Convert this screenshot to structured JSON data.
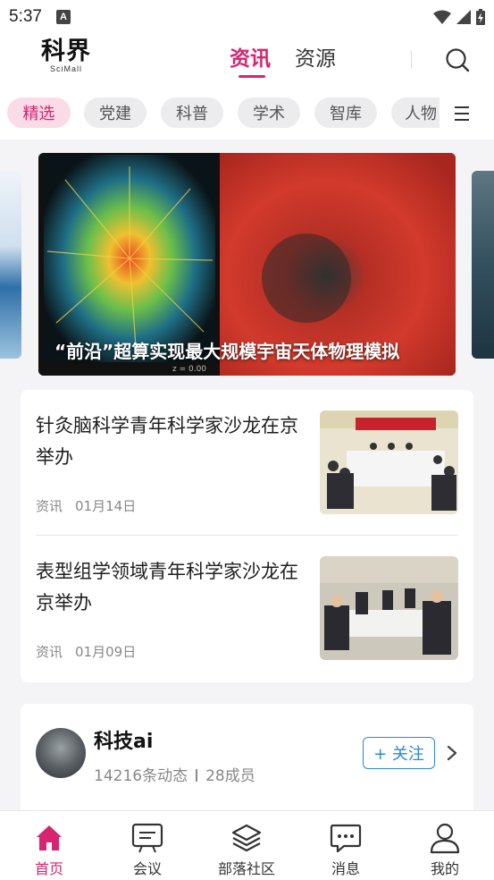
{
  "status_bar": {
    "time": "5:37",
    "notification_letter": "A"
  },
  "header": {
    "logo_main": "科界",
    "logo_sub": "SciMall",
    "tabs": [
      {
        "label": "资讯",
        "active": true
      },
      {
        "label": "资源",
        "active": false
      }
    ]
  },
  "categories": [
    {
      "label": "精选",
      "active": true
    },
    {
      "label": "党建",
      "active": false
    },
    {
      "label": "科普",
      "active": false
    },
    {
      "label": "学术",
      "active": false
    },
    {
      "label": "智库",
      "active": false
    },
    {
      "label": "人物",
      "active": false
    }
  ],
  "banner": {
    "caption": "“前沿”超算实现最大规模宇宙天体物理模拟"
  },
  "news": [
    {
      "title": "针灸脑科学青年科学家沙龙在京举办",
      "source": "资讯",
      "date": "01月14日"
    },
    {
      "title": "表型组学领域青年科学家沙龙在京举办",
      "source": "资讯",
      "date": "01月09日"
    }
  ],
  "group": {
    "name": "科技ai",
    "posts": "14216条动态",
    "members": "28成员",
    "follow_label": "+ 关注"
  },
  "bottom_nav": [
    {
      "label": "首页",
      "icon": "home-icon",
      "active": true
    },
    {
      "label": "会议",
      "icon": "meeting-icon",
      "active": false
    },
    {
      "label": "部落社区",
      "icon": "community-layers-icon",
      "active": false
    },
    {
      "label": "消息",
      "icon": "message-icon",
      "active": false
    },
    {
      "label": "我的",
      "icon": "profile-icon",
      "active": false
    }
  ],
  "colors": {
    "accent": "#d6246e",
    "follow": "#2a88d8"
  }
}
